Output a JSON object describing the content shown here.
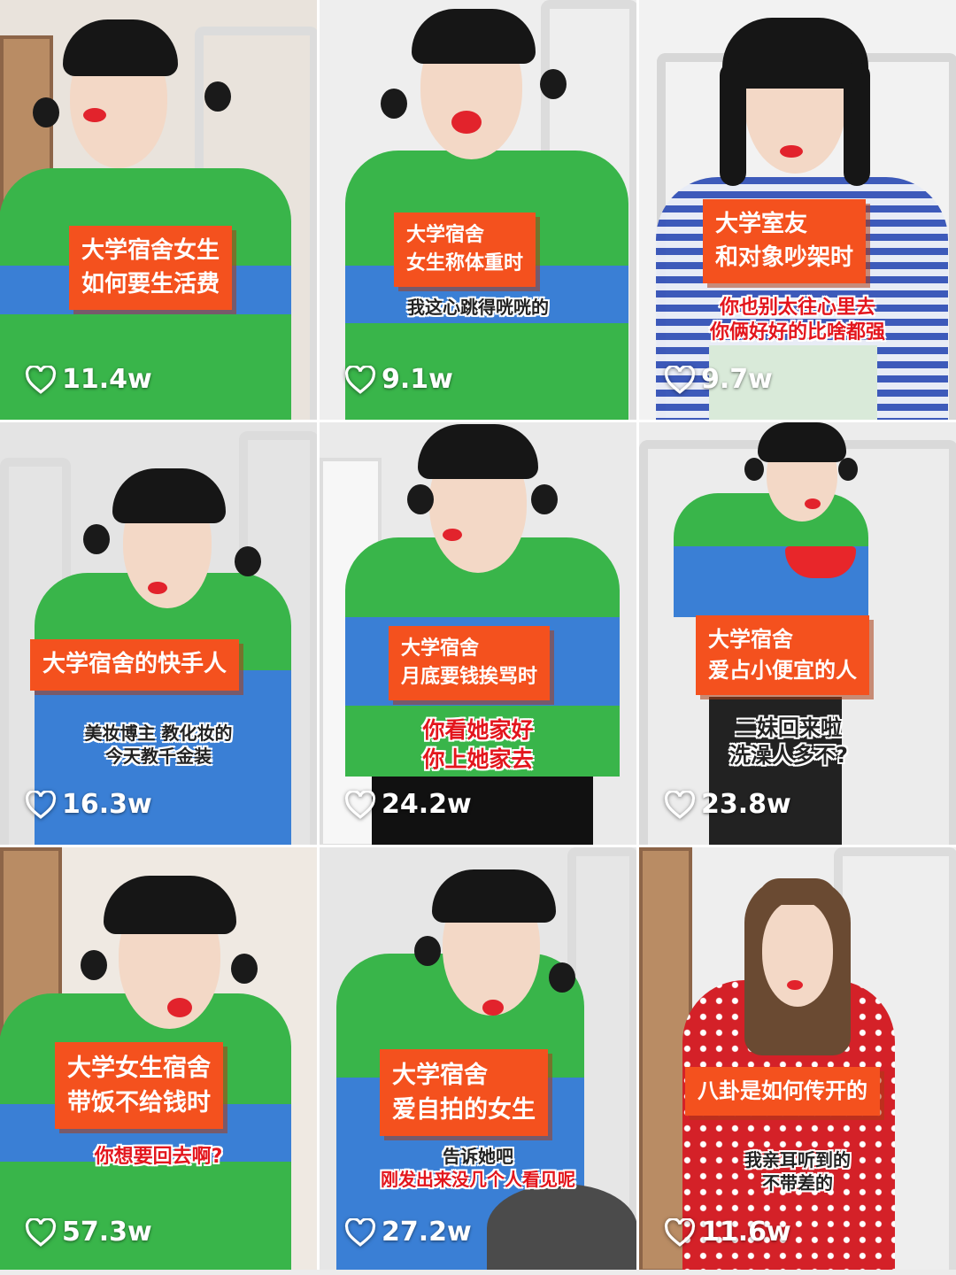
{
  "videos": [
    {
      "title_lines": [
        "大学宿舍女生",
        "如何要生活费"
      ],
      "subtitle_lines": [],
      "likes": "11.4w",
      "colors": {
        "wall": "#e9e3dc",
        "shirt_top": "#39b54a",
        "shirt_bottom": "#3a7fd5"
      }
    },
    {
      "title_lines": [
        "大学宿舍",
        "女生称体重时"
      ],
      "subtitle_lines": [
        "我这心跳得咣咣的"
      ],
      "likes": "9.1w",
      "colors": {
        "wall": "#eeeeee",
        "shirt_top": "#39b54a",
        "shirt_bottom": "#3a7fd5"
      }
    },
    {
      "title_lines": [
        "大学室友",
        "和对象吵架时"
      ],
      "subtitle_lines": [
        "你也别太往心里去",
        "你俩好好的比啥都强"
      ],
      "likes": "9.7w",
      "colors": {
        "wall": "#f2f2f2",
        "shirt_top": "#3452b8",
        "shirt_bottom": "#e8ecf7"
      }
    },
    {
      "title_lines": [
        "大学宿舍的快手人"
      ],
      "subtitle_lines": [
        "美妆博主 教化妆的",
        "今天教千金装"
      ],
      "likes": "16.3w",
      "colors": {
        "wall": "#e4e4e4",
        "shirt_top": "#39b54a",
        "shirt_bottom": "#3a7fd5"
      }
    },
    {
      "title_lines": [
        "大学宿舍",
        "月底要钱挨骂时"
      ],
      "subtitle_lines": [
        "你看她家好",
        "你上她家去"
      ],
      "likes": "24.2w",
      "colors": {
        "wall": "#eaeaea",
        "shirt_top": "#39b54a",
        "shirt_bottom": "#3a7fd5"
      }
    },
    {
      "title_lines": [
        "大学宿舍",
        "爱占小便宜的人"
      ],
      "subtitle_lines": [
        "二妹回来啦",
        "洗澡人多不?"
      ],
      "likes": "23.8w",
      "colors": {
        "wall": "#ececec",
        "shirt_top": "#39b54a",
        "shirt_bottom": "#3a7fd5"
      }
    },
    {
      "title_lines": [
        "大学女生宿舍",
        "带饭不给钱时"
      ],
      "subtitle_lines": [
        "你想要回去啊?"
      ],
      "likes": "57.3w",
      "colors": {
        "wall": "#efe9e2",
        "shirt_top": "#39b54a",
        "shirt_bottom": "#3a7fd5"
      }
    },
    {
      "title_lines": [
        "大学宿舍",
        "爱自拍的女生"
      ],
      "subtitle_lines": [
        "告诉她吧",
        "刚发出来没几个人看见呢"
      ],
      "likes": "27.2w",
      "colors": {
        "wall": "#e6e6e6",
        "shirt_top": "#39b54a",
        "shirt_bottom": "#3a7fd5"
      }
    },
    {
      "title_lines": [
        "八卦是如何传开的"
      ],
      "subtitle_lines": [
        "我亲耳听到的",
        "不带差的"
      ],
      "likes": "11.6w",
      "colors": {
        "wall": "#eeeeee",
        "shirt_top": "#d42128",
        "shirt_bottom": "#c91d24"
      }
    }
  ],
  "icons": {
    "like": "heart-outline-icon"
  },
  "accent": "#f4511e"
}
